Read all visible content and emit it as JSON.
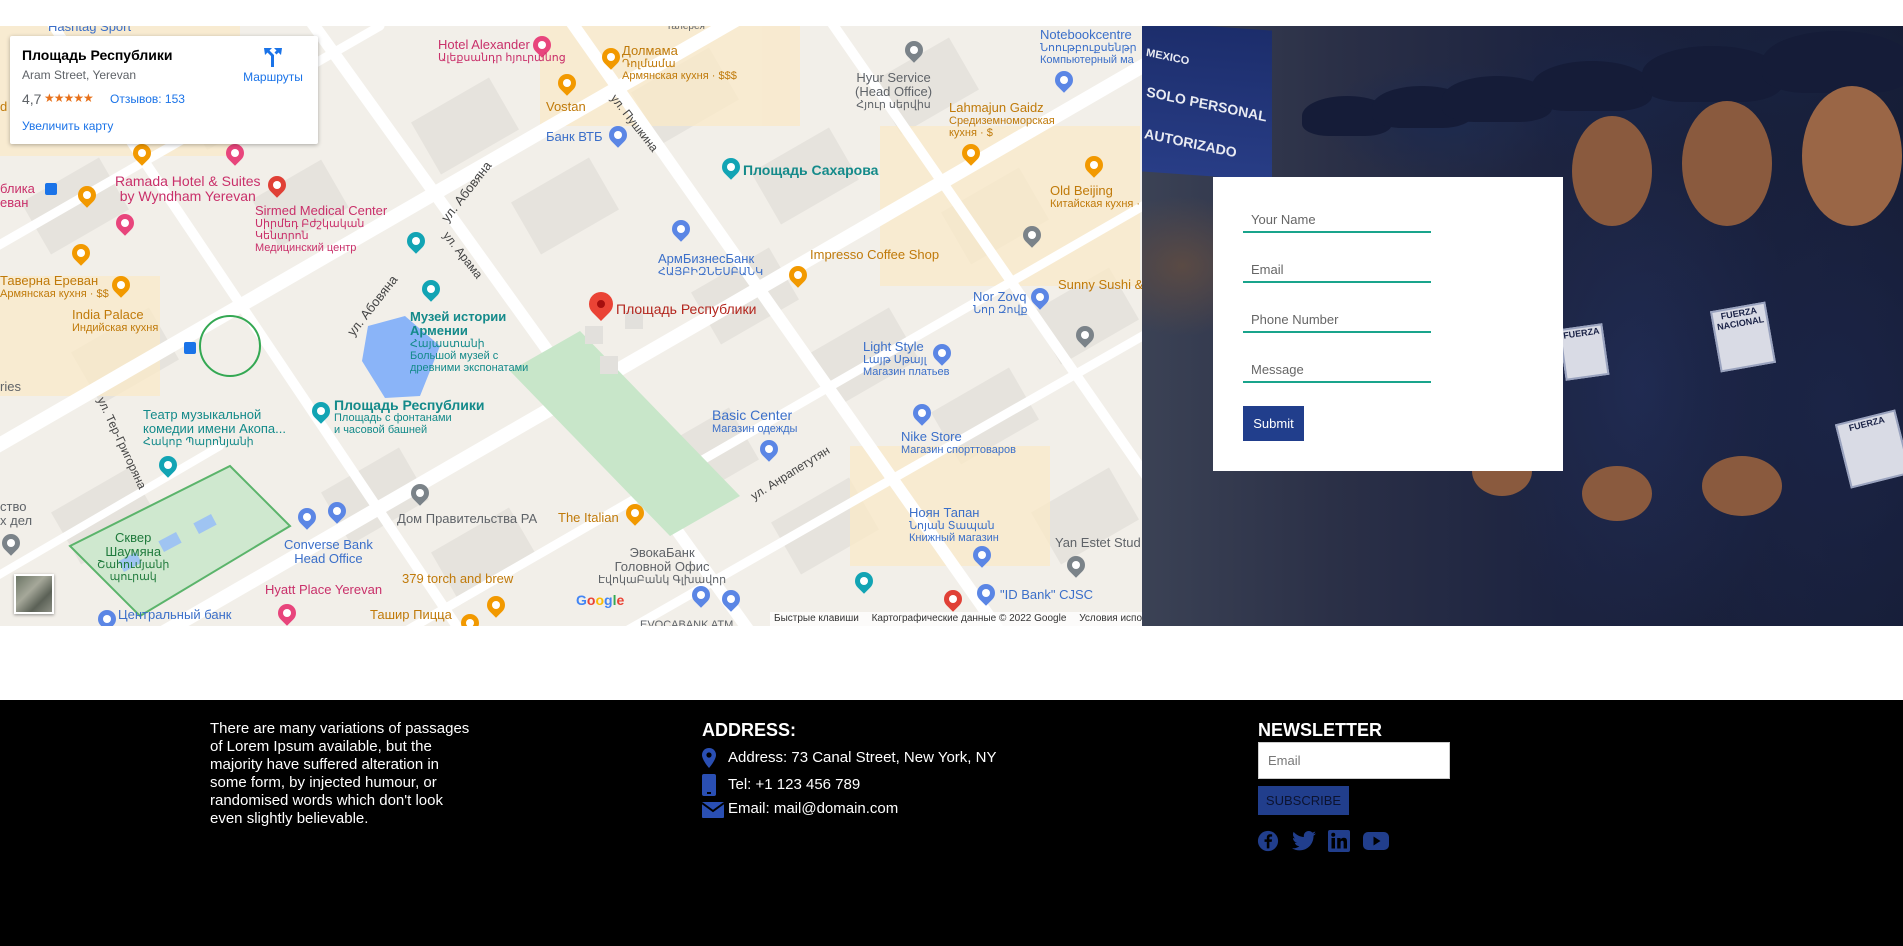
{
  "map": {
    "place_card": {
      "title": "Площадь Республики",
      "address": "Aram Street, Yerevan",
      "rating": "4,7",
      "stars": "★★★★★",
      "reviews": "Отзывов: 153",
      "enlarge_link": "Увеличить карту",
      "directions": "Маршруты"
    },
    "main_pin_label": "Площадь Республики",
    "labels": {
      "hashtag": "Hashtag Sport",
      "hotel_alexander": "Hotel Alexander",
      "hotel_alexander_sub": "Ալեքսանդր հյուրանոց",
      "dolmama": "Долмама",
      "dolmama_sub1": "Դոլմամա",
      "dolmama_sub2": "Армянская кухня · $$$",
      "vostan": "Vostan",
      "hyur": "Hyur Service",
      "hyur_sub1": "(Head Office)",
      "hyur_sub2": "Հյուր սերվիս",
      "notebook": "Notebookcentre",
      "notebook_sub1": "Նոութբուքսենթր",
      "notebook_sub2": "Компьютерный ма",
      "lahmajun": "Lahmajun Gaidz",
      "lahmajun_sub1": "Средиземноморская",
      "lahmajun_sub2": "кухня · $",
      "bank_vtb": "Банк ВТБ",
      "sakharova": "Площадь Сахарова",
      "ramada": "Ramada Hotel & Suites",
      "ramada2": "by Wyndham Yerevan",
      "sirmed": "Sirmed Medical Center",
      "sirmed_sub1": "Սիրմեդ Բժշկական",
      "sirmed_sub2": "Կենտրոն",
      "sirmed_sub3": "Медицинский центр",
      "old_beijing": "Old Beijing",
      "old_beijing_sub": "Китайская кухня · $$",
      "armbusiness": "АрмБизнесБанк",
      "armbusiness_sub": "ՀԱՅԲԻԶՆԵՍԲԱՆԿ",
      "impresso": "Impresso Coffee Shop",
      "taverna": "Таверна Ереван",
      "taverna_sub": "Армянская кухня · $$",
      "sunny_sushi": "Sunny Sushi &",
      "museum": "Музей истории",
      "museum2": "Армении",
      "museum_sub1": "Հայաստանի",
      "museum_sub2": "Большой музей с",
      "museum_sub3": "древними экспонатами",
      "nor_zovq": "Nor Zovq",
      "nor_zovq_sub": "Նոր Զովք",
      "india_palace": "India Palace",
      "india_palace_sub": "Индийская кухня",
      "light_style": "Light Style",
      "light_style_sub1": "Լայթ Սթայլ",
      "light_style_sub2": "Магазин платьев",
      "teatr": "Театр музыкальной",
      "teatr2": "комедии имени Акопа...",
      "teatr_sub": "Հակոբ Պարոնյանի",
      "republic_sq": "Площадь Республики",
      "republic_sq_sub1": "Площадь с фонтанами",
      "republic_sq_sub2": "и часовой башней",
      "basic_center": "Basic Center",
      "basic_center_sub": "Магазин одежды",
      "nike": "Nike Store",
      "nike_sub": "Магазин спорттоваров",
      "gov_house": "Дом Правительства РА",
      "the_italian": "The Italian",
      "noyan": "Ноян Тапан",
      "noyan_sub1": "Նոյան Տապան",
      "noyan_sub2": "Книжный магазин",
      "skver": "Сквер",
      "skver2": "Шаумяна",
      "skver_sub1": "Շահումյանի",
      "skver_sub2": "պուրակ",
      "converse": "Converse Bank",
      "converse2": "Head Office",
      "evokabank": "ЭвокаБанк",
      "evokabank2": "Головной Офис",
      "evokabank_sub": "ԷվոկաԲանկ Գլխավոր",
      "yan_estet": "Yan Estet Stud",
      "hyatt": "Hyatt Place Yerevan",
      "torch": "379 torch and brew",
      "tashir": "Ташир Пицца",
      "central_bank": "Центральный банк",
      "id_bank": "\"ID Bank\" CJSC",
      "evocabank_atm": "EVOCABANK ATM",
      "edge_blika": "блика",
      "edge_revan": "еван",
      "edge_ries": "ries",
      "edge_stvo": "ство",
      "edge_del": "х дел",
      "edge_pash": "d",
      "edge_galereya": "галерея",
      "edge_magazin": "Магазин спорт"
    },
    "streets": {
      "pushkina": "ул. Пушкина",
      "abovyana1": "ул. Абовяна",
      "abovyana2": "ул. Абовяна",
      "arama": "ул. Арама",
      "ter_grigoryana": "ул. Тер-Григоряна",
      "amiryana": "ул. Анрапетутян"
    },
    "google": [
      "G",
      "o",
      "o",
      "g",
      "l",
      "e"
    ],
    "attribution": {
      "shortcuts": "Быстрые клавиши",
      "data": "Картографические данные © 2022 Google",
      "terms": "Условия испо"
    }
  },
  "photo": {
    "sign_text1": "MEXICO",
    "sign_text2": "SOLO PERSONAL",
    "sign_text3": "AUTORIZADO",
    "patch1": "FUERZA NACIONAL",
    "patch2": "FUERZA",
    "patch3": "FUERZA"
  },
  "contact_form": {
    "name_placeholder": "Your Name",
    "email_placeholder": "Email",
    "phone_placeholder": "Phone Number",
    "message_placeholder": "Message",
    "submit_label": "Submit"
  },
  "footer": {
    "about": "There are many variations of passages of Lorem Ipsum available, but the majority have suffered alteration in some form, by injected humour, or randomised words which don't look even slightly believable.",
    "address_title": "ADDRESS:",
    "address": "Address: 73 Canal Street, New York, NY",
    "tel": "Tel: +1 123 456 789",
    "email": "Email: mail@domain.com",
    "newsletter_title": "NEWSLETTER",
    "newsletter_placeholder": "Email",
    "subscribe_label": "SUBSCRIBE",
    "social": [
      "facebook-icon",
      "twitter-icon",
      "linkedin-icon",
      "youtube-icon"
    ]
  },
  "colors": {
    "accent": "#213e8c",
    "field_underline": "#19a48c",
    "icon_blue": "#2a4fb3",
    "footer_bg": "#000000"
  }
}
